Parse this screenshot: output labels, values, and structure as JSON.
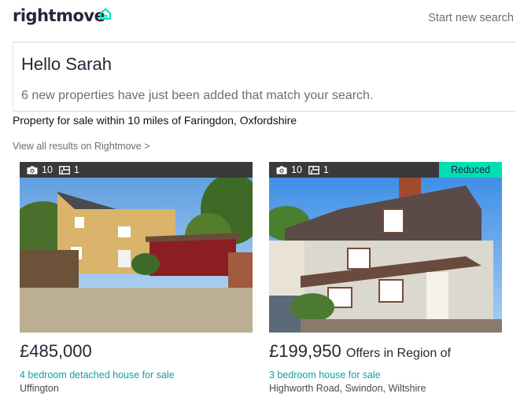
{
  "header": {
    "logo_text": "rightmove",
    "logo_icon": "house-outline-icon",
    "start_search_label": "Start new search",
    "brand_color": "#00deb6"
  },
  "greeting": {
    "title": "Hello Sarah",
    "subtitle": "6 new properties have just been added that match your search."
  },
  "search": {
    "title": "Property for sale within 10 miles of Faringdon, Oxfordshire",
    "view_all_label": "View all results on Rightmove >"
  },
  "listings": [
    {
      "photos_count": "10",
      "floorplans_count": "1",
      "badge": "",
      "price": "£485,000",
      "price_qualifier": "",
      "description": "4 bedroom detached house for sale",
      "address": "Uffington"
    },
    {
      "photos_count": "10",
      "floorplans_count": "1",
      "badge": "Reduced",
      "price": "£199,950",
      "price_qualifier": "Offers in Region of",
      "description": "3 bedroom house for sale",
      "address": "Highworth Road, Swindon, Wiltshire"
    }
  ]
}
